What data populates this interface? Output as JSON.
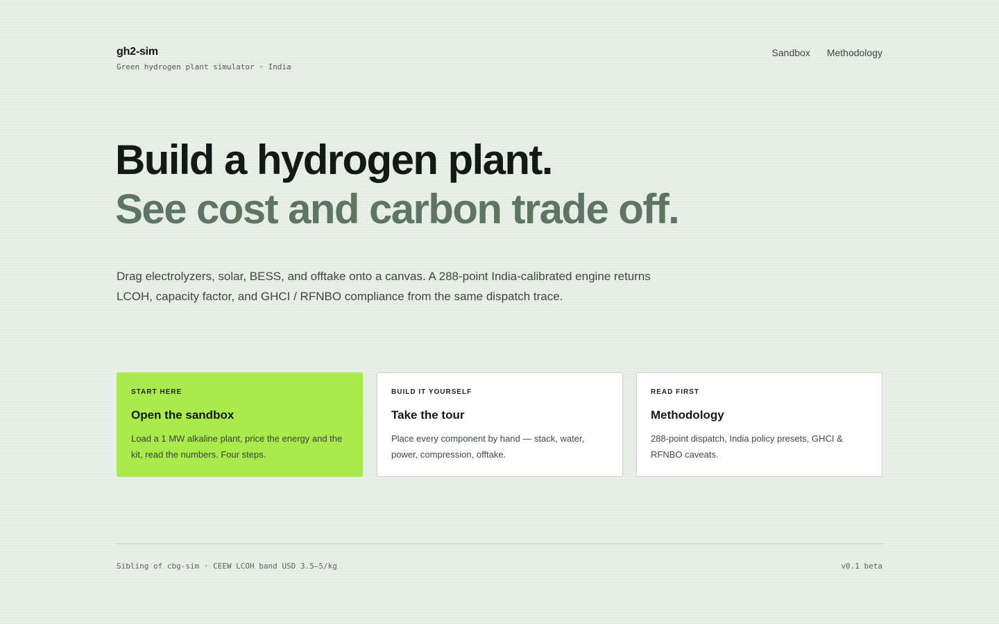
{
  "brand": {
    "name": "gh2-sim",
    "tagline": "Green hydrogen plant simulator · India"
  },
  "nav": {
    "items": [
      {
        "label": "Sandbox"
      },
      {
        "label": "Methodology"
      }
    ]
  },
  "hero": {
    "line1": "Build a hydrogen plant.",
    "line2": "See cost and carbon trade off.",
    "lede": "Drag electrolyzers, solar, BESS, and offtake onto a canvas. A 288-point India-calibrated engine returns LCOH, capacity factor, and GHCI / RFNBO compliance from the same dispatch trace."
  },
  "cards": [
    {
      "eyebrow": "START HERE",
      "title": "Open the sandbox",
      "body": "Load a 1 MW alkaline plant, price the energy and the kit, read the numbers. Four steps."
    },
    {
      "eyebrow": "BUILD IT YOURSELF",
      "title": "Take the tour",
      "body": "Place every component by hand — stack, water, power, compression, offtake."
    },
    {
      "eyebrow": "READ FIRST",
      "title": "Methodology",
      "body": "288-point dispatch, India policy presets, GHCI & RFNBO caveats."
    }
  ],
  "footer": {
    "left": "Sibling of cbg-sim · CEEW LCOH band USD 3.5–5/kg",
    "right": "v0.1 beta"
  },
  "colors": {
    "background": "#e7efe6",
    "accent": "#a9eb4b",
    "headline": "#121a13",
    "headline_muted": "#5d7562"
  }
}
